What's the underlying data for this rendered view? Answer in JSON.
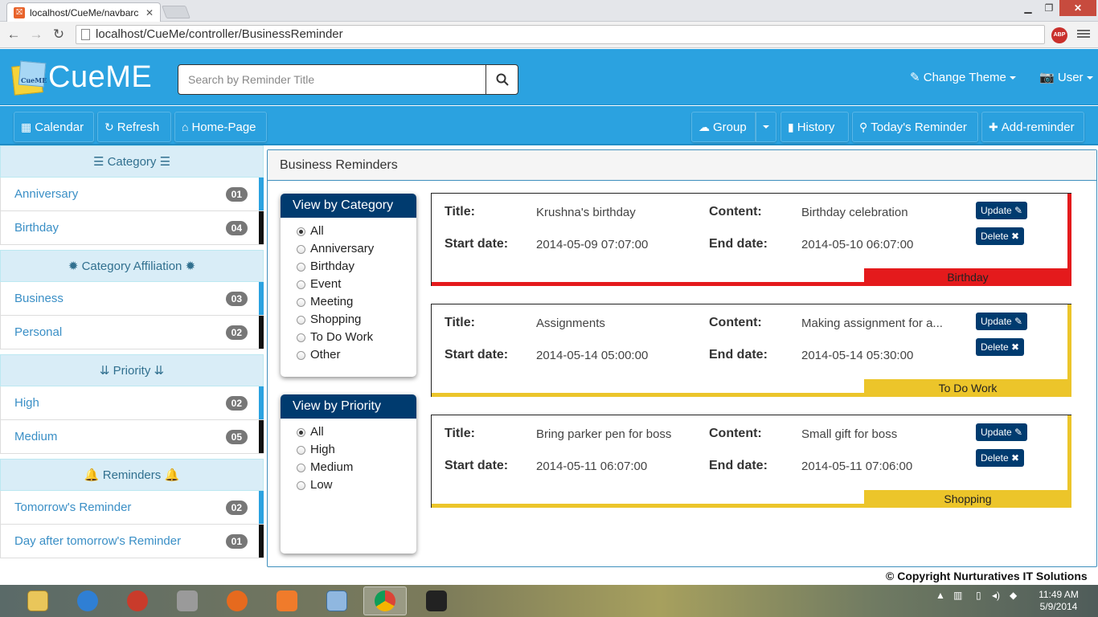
{
  "browser": {
    "tab_title": "localhost/CueMe/navbarc",
    "tab_close": "✕",
    "win_min": "▁",
    "win_max": "❐",
    "win_close": "✕",
    "url": "localhost/CueMe/controller/BusinessReminder",
    "abp_label": "ABP"
  },
  "app": {
    "brand": "CueME",
    "logo_text": "CueME",
    "search_placeholder": "Search by Reminder Title",
    "change_theme": "Change Theme",
    "user": "User"
  },
  "nav": {
    "calendar": "Calendar",
    "refresh": "Refresh",
    "home": "Home-Page",
    "group": "Group",
    "history": "History",
    "todays_reminder": "Today's Reminder",
    "add_reminder": "Add-reminder"
  },
  "sidebar": {
    "category_head": "Category",
    "categories": [
      {
        "label": "Anniversary",
        "count": "01"
      },
      {
        "label": "Birthday",
        "count": "04"
      }
    ],
    "affiliation_head": "Category Affiliation",
    "affiliations": [
      {
        "label": "Business",
        "count": "03"
      },
      {
        "label": "Personal",
        "count": "02"
      }
    ],
    "priority_head": "Priority",
    "priorities": [
      {
        "label": "High",
        "count": "02"
      },
      {
        "label": "Medium",
        "count": "05"
      }
    ],
    "reminders_head": "Reminders",
    "reminders": [
      {
        "label": "Tomorrow's Reminder",
        "count": "02"
      },
      {
        "label": "Day after tomorrow's Reminder",
        "count": "01"
      }
    ]
  },
  "main": {
    "title": "Business Reminders",
    "category_filter": {
      "heading": "View by Category",
      "options": [
        "All",
        "Anniversary",
        "Birthday",
        "Event",
        "Meeting",
        "Shopping",
        "To Do Work",
        "Other"
      ],
      "selected": "All"
    },
    "priority_filter": {
      "heading": "View by Priority",
      "options": [
        "All",
        "High",
        "Medium",
        "Low"
      ],
      "selected": "All"
    },
    "labels": {
      "title": "Title:",
      "content": "Content:",
      "start": "Start date:",
      "end": "End date:",
      "update": "Update",
      "delete": "Delete"
    },
    "reminders": [
      {
        "title": "Krushna's birthday",
        "content": "Birthday celebration",
        "start": "2014-05-09 07:07:00",
        "end": "2014-05-10 06:07:00",
        "category": "Birthday",
        "color": "#e41a1c"
      },
      {
        "title": "Assignments",
        "content": "Making assignment for a...",
        "start": "2014-05-14 05:00:00",
        "end": "2014-05-14 05:30:00",
        "category": "To Do Work",
        "color": "#ecc52a"
      },
      {
        "title": "Bring parker pen for boss",
        "content": "Small gift for boss",
        "start": "2014-05-11 06:07:00",
        "end": "2014-05-11 07:06:00",
        "category": "Shopping",
        "color": "#ecc52a"
      }
    ]
  },
  "footer": {
    "copyright": "© Copyright Nurturatives IT Solutions"
  },
  "taskbar": {
    "time": "11:49 AM",
    "date": "5/9/2014"
  },
  "colors": {
    "header_blue": "#2ba2e0",
    "dark_navy": "#003b6f",
    "birthday_red": "#e41a1c",
    "yellow": "#ecc52a",
    "sidebar_link": "#3a8fc6"
  }
}
